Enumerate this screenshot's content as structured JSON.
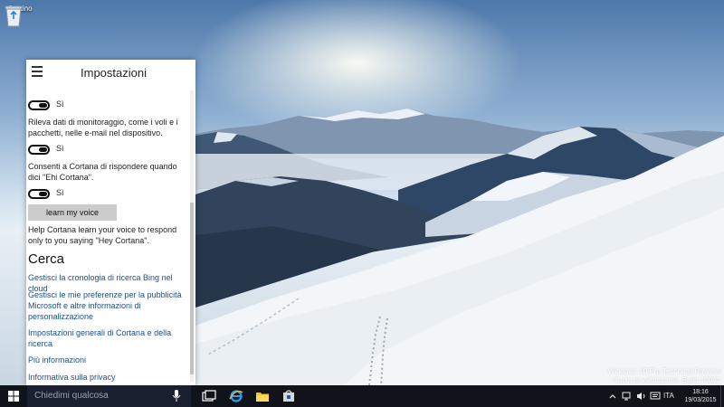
{
  "desktop": {
    "recycle_bin_label": "Cestino",
    "watermark": {
      "line1": "Windows 10 Pro Technical Preview",
      "line2": "Copia di valutazione. Build 10041"
    }
  },
  "panel": {
    "title": "Impostazioni",
    "toggles": [
      {
        "state_label": "Sì"
      },
      {
        "state_label": "Sì"
      },
      {
        "state_label": "Sì"
      }
    ],
    "descriptions": [
      "Rileva dati di monitoraggio, come i voli e i pacchetti, nelle e-mail nel dispositivo.",
      "Consenti a Cortana di rispondere quando dici \"Ehi Cortana\"."
    ],
    "voice_button_label": "learn my voice",
    "voice_help": "Help Cortana learn your voice to respond only to you saying \"Hey Cortana\".",
    "section_title": "Cerca",
    "links": [
      "Gestisci la cronologia di ricerca Bing nel cloud",
      "Gestisci le mie preferenze per la pubblicità Microsoft e altre informazioni di personalizzazione",
      "Impostazioni generali di Cortana e della ricerca",
      "Più informazioni",
      "Informativa sulla privacy"
    ]
  },
  "taskbar": {
    "search_placeholder": "Chiedimi qualcosa",
    "language": "ITA",
    "time": "18:16",
    "date": "19/03/2015"
  },
  "colors": {
    "taskbar": "#10131a",
    "search_box": "#1b2030",
    "link": "#1f4e86",
    "button_bg": "#cccccc"
  }
}
